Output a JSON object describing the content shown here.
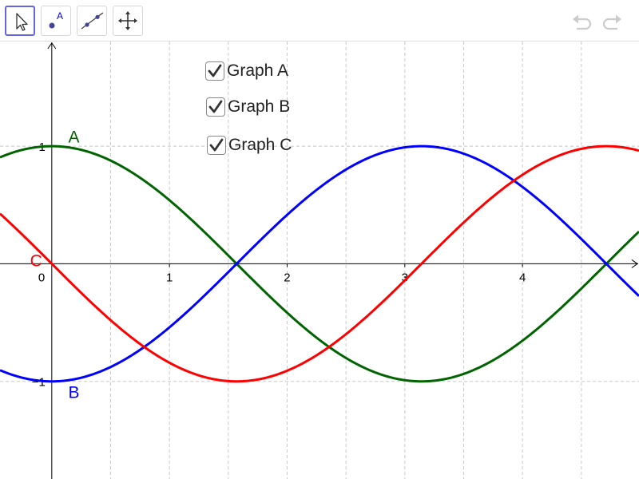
{
  "toolbar": {
    "tools": [
      {
        "name": "move-tool",
        "icon": "arrow-pointer-icon",
        "selected": true
      },
      {
        "name": "point-tool",
        "icon": "point-icon",
        "selected": false,
        "glyph": "A"
      },
      {
        "name": "line-tool",
        "icon": "line-through-two-points-icon",
        "selected": false
      },
      {
        "name": "move-graphics-view-tool",
        "icon": "four-way-arrow-icon",
        "selected": false
      }
    ],
    "undo_icon": "undo-icon",
    "redo_icon": "redo-icon",
    "accent_color": "#6464e6"
  },
  "checkboxes": [
    {
      "label": "Graph A",
      "checked": true
    },
    {
      "label": "Graph B",
      "checked": true
    },
    {
      "label": "Graph C",
      "checked": true
    }
  ],
  "axes": {
    "origin_label": "0",
    "x_ticks": [
      {
        "value": 1,
        "label": "1"
      },
      {
        "value": 2,
        "label": "2"
      },
      {
        "value": 3,
        "label": "3"
      },
      {
        "value": 4,
        "label": "4"
      }
    ],
    "y_ticks": [
      {
        "value": 1,
        "label": "1"
      },
      {
        "value": -1,
        "label": "−1"
      }
    ],
    "x_range": [
      -0.44,
      4.99
    ],
    "y_range": [
      -1.83,
      1.89
    ]
  },
  "graphs": [
    {
      "label": "A",
      "expression": "cos(x)",
      "color": "#006400"
    },
    {
      "label": "B",
      "expression": "-cos(x)",
      "color": "#0000ff"
    },
    {
      "label": "C",
      "expression": "-sin(x)",
      "color": "#ff0000"
    }
  ]
}
